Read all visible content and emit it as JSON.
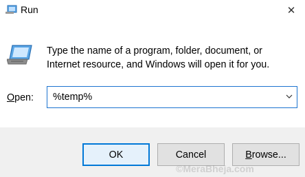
{
  "window": {
    "title": "Run",
    "close_symbol": "✕"
  },
  "description": "Type the name of a program, folder, document, or Internet resource, and Windows will open it for you.",
  "open": {
    "label_mnemonic": "O",
    "label_rest": "pen:",
    "value": "%temp%"
  },
  "buttons": {
    "ok": "OK",
    "cancel": "Cancel",
    "browse_mnemonic": "B",
    "browse_rest": "rowse..."
  },
  "watermark": "©MeraBheja.com",
  "icons": {
    "app": "run-app-icon",
    "run": "run-dialog-icon",
    "close": "close-icon",
    "dropdown": "chevron-down-icon"
  },
  "colors": {
    "accent": "#0078d7",
    "focus_border": "#1b73d0",
    "footer_bg": "#f0f0f0",
    "button_bg": "#e1e1e1"
  }
}
